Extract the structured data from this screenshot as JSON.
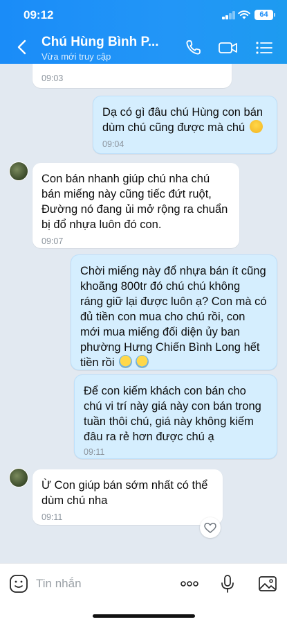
{
  "status_bar": {
    "time": "09:12",
    "battery": "64"
  },
  "header": {
    "contact_name": "Chú Hùng Bình P...",
    "subtitle": "Vừa mới truy cập",
    "icons": [
      "back-arrow-icon",
      "phone-icon",
      "video-call-icon",
      "menu-list-icon"
    ]
  },
  "messages": [
    {
      "direction": "in",
      "lines": [],
      "time": "09:03"
    },
    {
      "direction": "out",
      "lines": [
        "Dạ có gì đâu chú Hùng con bán",
        "dùm chú cũng được mà chú"
      ],
      "emoji": "smiling-face-emoji",
      "time": "09:04"
    },
    {
      "direction": "in",
      "lines": [
        "Con bán nhanh giúp chú nha chú",
        "bán miếng này cũng tiếc đứt ruột,",
        "Đường nó đang ủi mở rộng ra chuẩn",
        "bị đổ nhựa luôn đó con."
      ],
      "time": "09:07"
    },
    {
      "direction": "out",
      "lines": [
        "Chời miếng này đổ nhựa bán ít cũng",
        "khoãng 800tr đó chú chú không",
        "ráng giữ lại được luôn ạ? Con mà có",
        "đủ tiền con mua cho chú rồi, con",
        "mới mua miếng đối diện ủy ban",
        "phường Hưng Chiến Bình Long hết",
        "tiền rồi"
      ],
      "emoji": "crying-face-emoji"
    },
    {
      "direction": "out",
      "lines": [
        "Để con kiếm khách con bán cho",
        "chú vi trí này giá này con bán trong",
        "tuần thôi chú, giá này không kiếm",
        "đâu ra rẻ hơn được chú ạ"
      ],
      "time": "09:11"
    },
    {
      "direction": "in",
      "lines": [
        "Ừ Con giúp bán sớm nhất có thể",
        "dùm chú nha"
      ],
      "time": "09:11"
    }
  ],
  "composer": {
    "placeholder": "Tin nhắn",
    "icons": [
      "sticker-icon",
      "more-dots-icon",
      "microphone-icon",
      "image-icon"
    ]
  },
  "colors": {
    "header": "#1a8cf8",
    "chat_background": "#e2e9f1",
    "outgoing_bubble": "#d5eefe",
    "incoming_bubble": "#ffffff"
  }
}
